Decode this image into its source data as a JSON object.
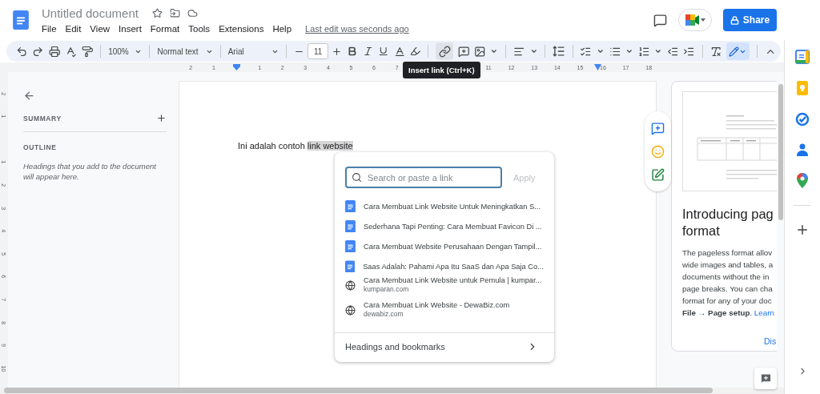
{
  "header": {
    "title": "Untitled document",
    "menu": [
      "File",
      "Edit",
      "View",
      "Insert",
      "Format",
      "Tools",
      "Extensions",
      "Help"
    ],
    "last_edit": "Last edit was seconds ago",
    "share_label": "Share"
  },
  "toolbar": {
    "zoom": "100%",
    "style": "Normal text",
    "font": "Arial",
    "font_size": "11",
    "link_hovered": true,
    "edit_mode_selected": true
  },
  "tooltip": "Insert link (Ctrl+K)",
  "ruler": {
    "top_segments": [
      [
        "2",
        "1"
      ],
      [
        "1",
        "2",
        "3",
        "4",
        "5",
        "6",
        "7"
      ],
      [
        "11",
        "12",
        "13",
        "14",
        "15",
        "16",
        "17",
        "18"
      ]
    ],
    "side_segments": [
      [
        "2",
        "1"
      ],
      [
        "1",
        "2",
        "3",
        "4",
        "5",
        "6",
        "7",
        "8",
        "9",
        "10"
      ]
    ]
  },
  "outline_panel": {
    "summary_label": "SUMMARY",
    "outline_label": "OUTLINE",
    "hint": "Headings that you add to the document will appear here."
  },
  "document": {
    "text": "Ini adalah contoh",
    "selected_text": "link website"
  },
  "link_popup": {
    "search": {
      "placeholder": "Search or paste a link"
    },
    "apply": {
      "label": "Apply",
      "disabled": true
    },
    "suggestions": [
      {
        "kind": "doc",
        "title": "Cara Membuat Link Website Untuk Meningkatkan S..."
      },
      {
        "kind": "doc",
        "title": "Sederhana Tapi Penting: Cara Membuat Favicon Di ..."
      },
      {
        "kind": "doc",
        "title": "Cara Membuat Website Perusahaan Dengan Tampil..."
      },
      {
        "kind": "doc",
        "title": "Saas Adalah: Pahami Apa Itu SaaS dan Apa Saja Co..."
      },
      {
        "kind": "web",
        "title": "Cara Membuat Link Website untuk Pemula | kumpar...",
        "url": "kumparan.com"
      },
      {
        "kind": "web",
        "title": "Cara Membuat Link Website - DewaBiz.com",
        "url": "dewabiz.com"
      }
    ],
    "footer": "Headings and bookmarks"
  },
  "promo_card": {
    "title_lines": [
      "Introducing pag",
      "format"
    ],
    "body_lines": [
      "The pageless format allov",
      "wide images and tables, a",
      "documents without the in",
      "page breaks. You can cha",
      "format for any of your doc"
    ],
    "last_line": {
      "text": "**File → Page setup**.",
      "link": "Learn"
    },
    "dismiss": "Dis"
  }
}
